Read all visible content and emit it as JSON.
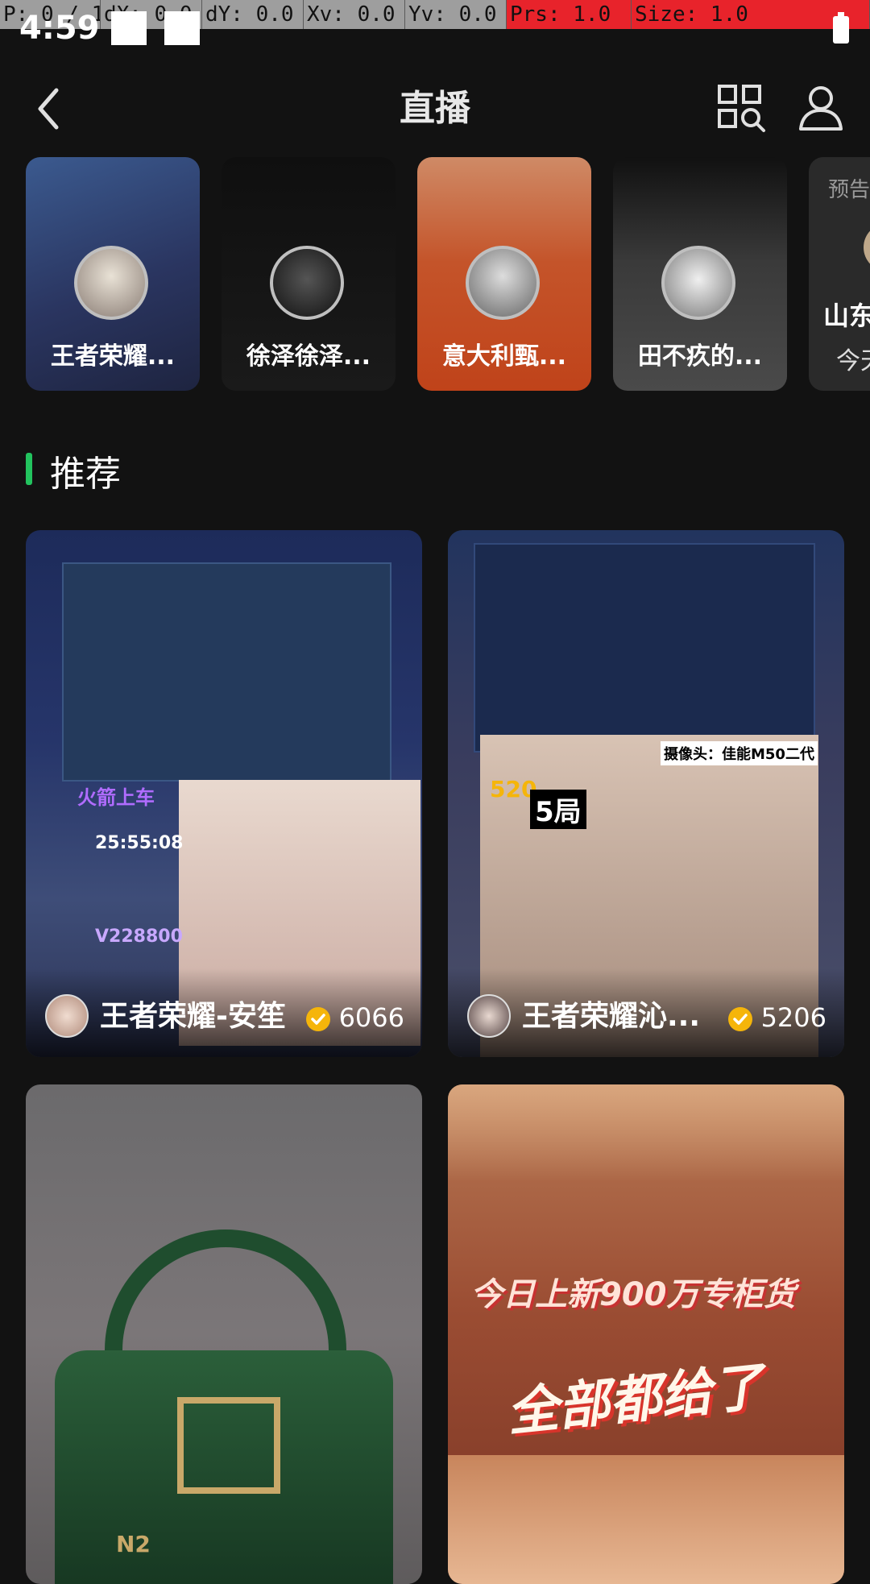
{
  "debug_bar": {
    "p": "P: 0 / 1",
    "dx": "dX: 0.0",
    "dy": "dY: 0.0",
    "xv": "Xv: 0.0",
    "yv": "Yv: 0.0",
    "prs": "Prs: 1.0",
    "size": "Size: 1.0"
  },
  "status_bar": {
    "time": "4:59"
  },
  "header": {
    "title": "直播",
    "back_icon": "chevron-left-icon",
    "grid_icon": "grid-search-icon",
    "user_icon": "user-icon"
  },
  "live_row": {
    "items": [
      {
        "name": "王者荣耀..."
      },
      {
        "name": "徐泽徐泽..."
      },
      {
        "name": "意大利甄..."
      },
      {
        "name": "田不疚的..."
      }
    ],
    "preview": {
      "tag": "预告",
      "name": "山东",
      "sub": "今天"
    }
  },
  "section": {
    "title": "推荐"
  },
  "feed": {
    "cards": [
      {
        "name": "王者荣耀-安笙",
        "count": "6066",
        "overlay": {
          "line1": "火箭上车",
          "timer": "25:55:08",
          "contact": "V228800"
        }
      },
      {
        "name": "王者荣耀沁...",
        "count": "5206",
        "overlay": {
          "camera": "摄像头：佳能M50二代",
          "badge": "520",
          "rounds": "5局"
        }
      },
      {
        "name": "",
        "count": "",
        "overlay": {
          "brand": "N2"
        }
      },
      {
        "name": "",
        "count": "",
        "overlay": {
          "line1": "今日上新900万专柜货",
          "line2": "全部都给了"
        }
      }
    ]
  },
  "colors": {
    "background": "#121212",
    "accent_green": "#22c35e",
    "debug_red": "#e8232b",
    "verify_gold": "#f5b50a"
  }
}
